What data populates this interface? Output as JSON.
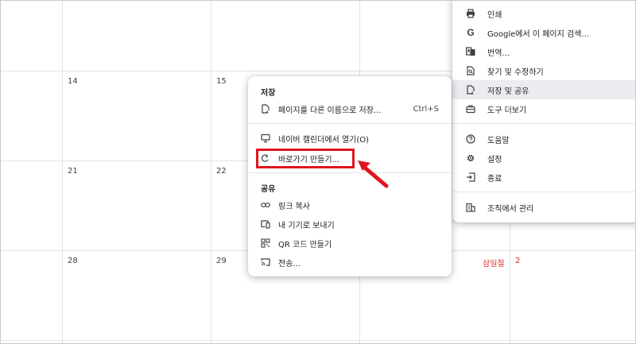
{
  "calendar": {
    "days": [
      {
        "num": "14",
        "holiday": false
      },
      {
        "num": "15",
        "holiday": false
      },
      {
        "num": "21",
        "holiday": false
      },
      {
        "num": "22",
        "holiday": false
      },
      {
        "num": "28",
        "holiday": false
      },
      {
        "num": "29",
        "holiday": false
      },
      {
        "num": "2",
        "holiday": true
      }
    ],
    "holiday_label": "삼일절"
  },
  "main_menu": {
    "items": [
      {
        "label": "인쇄",
        "icon": "printer-icon"
      },
      {
        "label": "Google에서 이 페이지 검색...",
        "icon": "google-icon"
      },
      {
        "label": "번역...",
        "icon": "translate-icon"
      },
      {
        "label": "찾기 및 수정하기",
        "icon": "find-edit-icon"
      },
      {
        "label": "저장 및 공유",
        "icon": "save-share-icon"
      },
      {
        "label": "도구 더보기",
        "icon": "toolbox-icon"
      },
      {
        "label": "도움말",
        "icon": "help-icon"
      },
      {
        "label": "설정",
        "icon": "gear-icon"
      },
      {
        "label": "종료",
        "icon": "exit-icon"
      },
      {
        "label": "조직에서 관리",
        "icon": "building-icon"
      }
    ],
    "google_letter": "G"
  },
  "sub_menu": {
    "save_title": "저장",
    "save_page_as": "페이지를 다른 이름으로 저장...",
    "save_page_shortcut": "Ctrl+S",
    "open_in_calendar": "네이버 캘린더에서 열기(O)",
    "create_shortcut": "바로가기 만들기...",
    "share_title": "공유",
    "copy_link": "링크 복사",
    "send_to_devices": "내 기기로 보내기",
    "create_qr": "QR 코드 만들기",
    "cast": "전송..."
  },
  "colors": {
    "highlight_box": "#e0151d",
    "holiday": "#d93025",
    "menu_hover": "#ebebf0"
  }
}
